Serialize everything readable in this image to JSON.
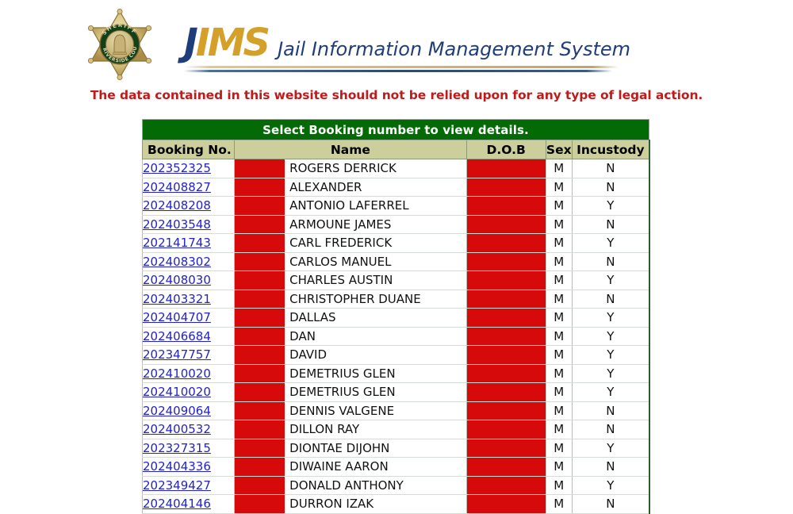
{
  "header": {
    "badge": {
      "icon": "sheriff-star-badge-icon",
      "top_text": "SHERIFF",
      "bottom_text": "RIVERSIDE COUNTY"
    },
    "logo_mark_primary": "J",
    "logo_mark_secondary": "IMS",
    "tagline": "Jail Information Management System",
    "colors": {
      "logo_navy": "#1F3D7A",
      "logo_gold": "#D4A029"
    }
  },
  "warning": {
    "text": "The data contained in this website should not be relied upon for any type of legal action.",
    "color": "#C01A1A"
  },
  "table": {
    "title": "Select Booking number to view details.",
    "title_bg": "#046A06",
    "header_bg": "#CCCE9B",
    "redaction_color": "#D60A0A",
    "columns": [
      "Booking No.",
      "Name",
      "D.O.B",
      "Sex",
      "Incustody"
    ],
    "rows": [
      {
        "booking": "202352325",
        "name": "ROGERS  DERRICK",
        "dob": "",
        "sex": "M",
        "incustody": "N"
      },
      {
        "booking": "202408827",
        "name": "ALEXANDER",
        "dob": "",
        "sex": "M",
        "incustody": "N"
      },
      {
        "booking": "202408208",
        "name": "ANTONIO LAFERREL",
        "dob": "",
        "sex": "M",
        "incustody": "Y"
      },
      {
        "booking": "202403548",
        "name": "ARMOUNE JAMES",
        "dob": "",
        "sex": "M",
        "incustody": "N"
      },
      {
        "booking": "202141743",
        "name": "CARL FREDERICK",
        "dob": "",
        "sex": "M",
        "incustody": "Y"
      },
      {
        "booking": "202408302",
        "name": "CARLOS MANUEL",
        "dob": "",
        "sex": "M",
        "incustody": "N"
      },
      {
        "booking": "202408030",
        "name": "CHARLES AUSTIN",
        "dob": "",
        "sex": "M",
        "incustody": "Y"
      },
      {
        "booking": "202403321",
        "name": "CHRISTOPHER DUANE",
        "dob": "",
        "sex": "M",
        "incustody": "N"
      },
      {
        "booking": "202404707",
        "name": "DALLAS",
        "dob": "",
        "sex": "M",
        "incustody": "Y"
      },
      {
        "booking": "202406684",
        "name": "DAN",
        "dob": "",
        "sex": "M",
        "incustody": "Y"
      },
      {
        "booking": "202347757",
        "name": "DAVID",
        "dob": "",
        "sex": "M",
        "incustody": "Y"
      },
      {
        "booking": "202410020",
        "name": "DEMETRIUS GLEN",
        "dob": "",
        "sex": "M",
        "incustody": "Y"
      },
      {
        "booking": "202410020",
        "name": "DEMETRIUS GLEN",
        "dob": "",
        "sex": "M",
        "incustody": "Y"
      },
      {
        "booking": "202409064",
        "name": "DENNIS VALGENE",
        "dob": "",
        "sex": "M",
        "incustody": "N"
      },
      {
        "booking": "202400532",
        "name": "DILLON RAY",
        "dob": "",
        "sex": "M",
        "incustody": "N"
      },
      {
        "booking": "202327315",
        "name": "DIONTAE DIJOHN",
        "dob": "",
        "sex": "M",
        "incustody": "Y"
      },
      {
        "booking": "202404336",
        "name": "DIWAINE AARON",
        "dob": "",
        "sex": "M",
        "incustody": "N"
      },
      {
        "booking": "202349427",
        "name": "DONALD ANTHONY",
        "dob": "",
        "sex": "M",
        "incustody": "Y"
      },
      {
        "booking": "202404146",
        "name": "DURRON IZAK",
        "dob": "",
        "sex": "M",
        "incustody": "N"
      }
    ]
  }
}
